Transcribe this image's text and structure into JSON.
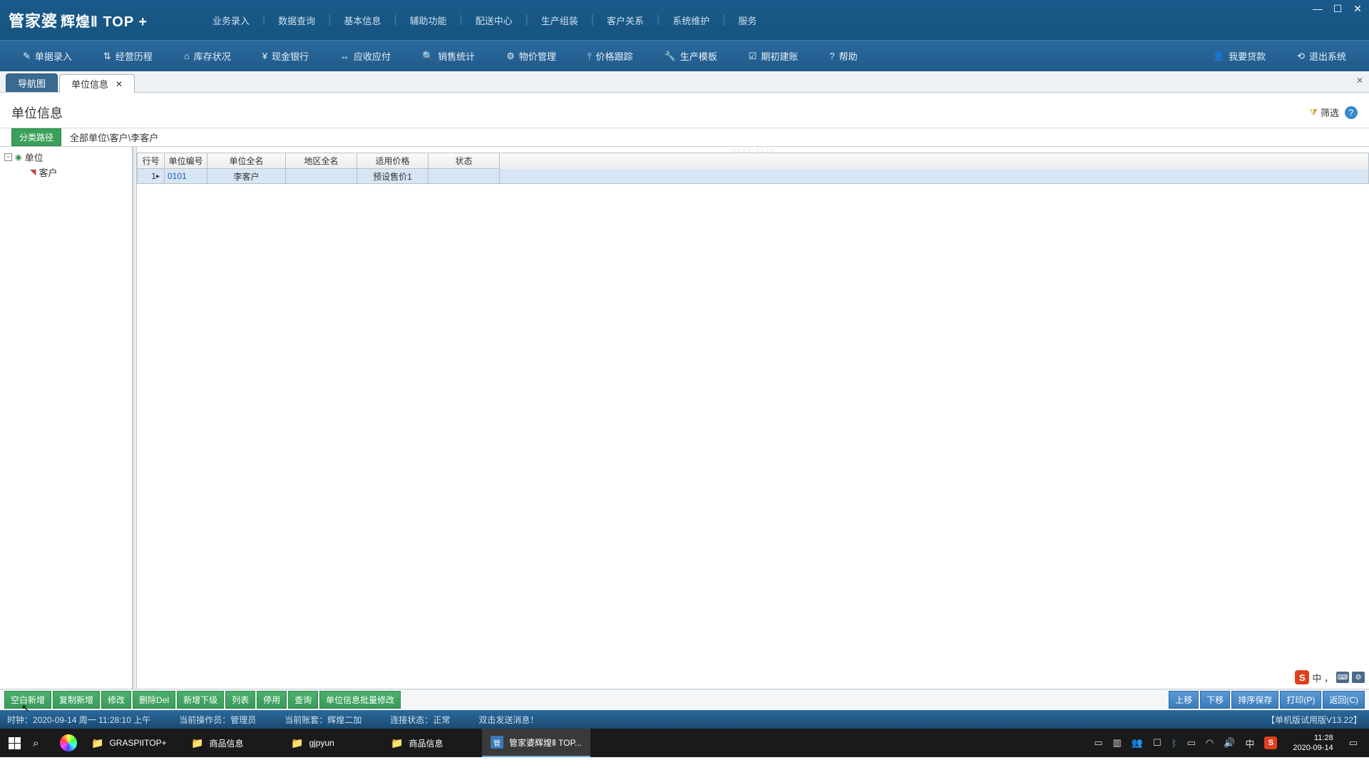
{
  "app": {
    "name": "管家婆",
    "suffix": "辉煌Ⅱ TOP +"
  },
  "window_controls": {
    "min": "—",
    "max": "☐",
    "close": "✕"
  },
  "menu": [
    "业务录入",
    "数据查询",
    "基本信息",
    "辅助功能",
    "配送中心",
    "生产组装",
    "客户关系",
    "系统维护",
    "服务"
  ],
  "toolbar": [
    {
      "icon": "✎",
      "label": "单据录入"
    },
    {
      "icon": "⇅",
      "label": "经营历程"
    },
    {
      "icon": "⌂",
      "label": "库存状况"
    },
    {
      "icon": "¥",
      "label": "现金银行"
    },
    {
      "icon": "↔",
      "label": "应收应付"
    },
    {
      "icon": "🔍",
      "label": "销售统计"
    },
    {
      "icon": "⚙",
      "label": "物价管理"
    },
    {
      "icon": "⫯",
      "label": "价格跟踪"
    },
    {
      "icon": "🔧",
      "label": "生产模板"
    },
    {
      "icon": "☑",
      "label": "期初建账"
    },
    {
      "icon": "?",
      "label": "帮助"
    }
  ],
  "toolbar_right": [
    {
      "icon": "👤",
      "label": "我要贷款"
    },
    {
      "icon": "⟲",
      "label": "退出系统"
    }
  ],
  "tabs": {
    "inactive": "导航图",
    "active": "单位信息"
  },
  "page": {
    "title": "单位信息",
    "filter_label": "筛选",
    "path_btn": "分类路径",
    "breadcrumb": "全部单位\\客户\\李客户"
  },
  "tree": {
    "root": "单位",
    "child": "客户"
  },
  "grid": {
    "headers": [
      "行号",
      "单位编号",
      "单位全名",
      "地区全名",
      "适用价格",
      "状态"
    ],
    "widths": [
      38,
      60,
      110,
      100,
      100,
      100
    ],
    "row": {
      "num": "1",
      "code": "0101",
      "name": "李客户",
      "region": "",
      "price": "预设售价1",
      "status": ""
    }
  },
  "ime": {
    "mode": "中 ，"
  },
  "actions_left": [
    "空白新增",
    "复制新增",
    "修改",
    "删除Del",
    "新增下级",
    "列表",
    "停用",
    "查询",
    "单位信息批量修改"
  ],
  "actions_right": [
    "上移",
    "下移",
    "排序保存",
    "打印(P)",
    "返回(C)"
  ],
  "status": {
    "time_label": "时钟：",
    "time_value": "2020-09-14 周一 11:28:10 上午",
    "operator_label": "当前操作员：",
    "operator_value": "管理员",
    "account_label": "当前账套：",
    "account_value": "辉煌二加",
    "conn_label": "连接状态：",
    "conn_value": "正常",
    "hint": "双击发送消息！",
    "version": "【单机版试用版V13.22】"
  },
  "taskbar": {
    "items": [
      {
        "type": "folder",
        "label": "GRASPIITOP+"
      },
      {
        "type": "folder",
        "label": "商品信息"
      },
      {
        "type": "folder",
        "label": "gjpyun"
      },
      {
        "type": "folder",
        "label": "商品信息"
      },
      {
        "type": "app",
        "label": "管家婆辉煌Ⅱ TOP...",
        "active": true
      }
    ],
    "clock_time": "11:28",
    "clock_date": "2020-09-14"
  }
}
